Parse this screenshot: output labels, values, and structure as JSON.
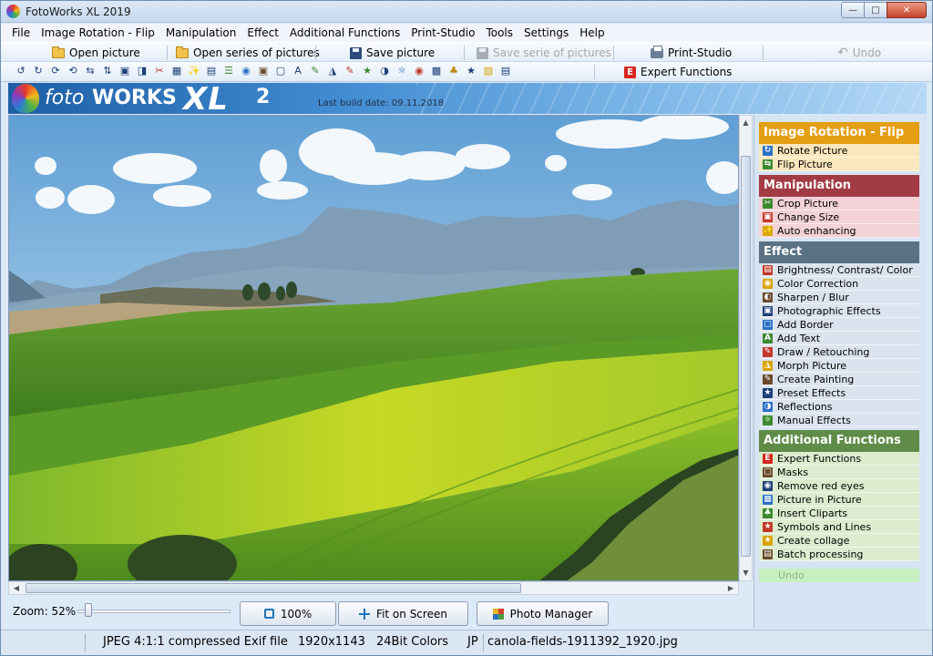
{
  "window": {
    "title": "FotoWorks XL 2019"
  },
  "menu": [
    "File",
    "Image Rotation - Flip",
    "Manipulation",
    "Effect",
    "Additional Functions",
    "Print-Studio",
    "Tools",
    "Settings",
    "Help"
  ],
  "quickbar": {
    "open_picture": "Open picture",
    "open_series": "Open series of pictures",
    "save_picture": "Save picture",
    "save_series": "Save serie of pictures",
    "print_studio": "Print-Studio",
    "undo": "Undo"
  },
  "toolbar": {
    "icons": [
      "rotate-left-icon",
      "rotate-right-icon",
      "rotate-ccw-icon",
      "rotate-cw-icon",
      "flip-horizontal-icon",
      "flip-vertical-icon",
      "resize-icon",
      "crop-icon",
      "cut-icon",
      "transform-icon",
      "auto-enhance-icon",
      "levels-icon",
      "color-balance-icon",
      "effects-icon",
      "photo-icon",
      "frame-icon",
      "text-icon",
      "draw-icon",
      "morph-icon",
      "painting-icon",
      "preset-icon",
      "reflection-icon",
      "manual-effects-icon",
      "eye-icon",
      "picture-in-picture-icon",
      "clipart-icon",
      "symbols-icon",
      "collage-icon",
      "batch-icon"
    ],
    "expert_label": "Expert Functions"
  },
  "banner": {
    "logo_foto": "foto",
    "logo_works": "WORKS",
    "logo_xl": "XL",
    "logo_version": "2",
    "build_date": "Last build date: 09.11.2018"
  },
  "zoom": {
    "label": "Zoom: 52%",
    "level": 0.05
  },
  "buttons": {
    "zoom100": "100%",
    "fit": "Fit on Screen",
    "photo_manager": "Photo Manager"
  },
  "panel": {
    "categories": [
      {
        "title": "Image Rotation - Flip",
        "color": "#e49e13",
        "item_bg": "#fbe7bd",
        "items": [
          "Rotate Picture",
          "Flip Picture"
        ]
      },
      {
        "title": "Manipulation",
        "color": "#a33b44",
        "item_bg": "#f2d2d6",
        "items": [
          "Crop Picture",
          "Change Size",
          "Auto enhancing"
        ]
      },
      {
        "title": "Effect",
        "color": "#5a7184",
        "item_bg": "#dbe4ee",
        "items": [
          "Brightness/ Contrast/ Color",
          "Color Correction",
          "Sharpen / Blur",
          "Photographic Effects",
          "Add Border",
          "Add Text",
          "Draw / Retouching",
          "Morph Picture",
          "Create Painting",
          "Preset Effects",
          "Reflections",
          "Manual Effects"
        ]
      },
      {
        "title": "Additional Functions",
        "color": "#5f8c47",
        "item_bg": "#dceccf",
        "items": [
          "Expert Functions",
          "Masks",
          "Remove red eyes",
          "Picture in Picture",
          "Insert Cliparts",
          "Symbols and Lines",
          "Create collage",
          "Batch processing"
        ]
      }
    ],
    "undo": "Undo"
  },
  "status": {
    "format": "JPEG 4:1:1 compressed Exif file",
    "dimensions": "1920x1143",
    "depth": "24Bit Colors",
    "type": "JP",
    "filename": "canola-fields-1911392_1920.jpg"
  }
}
